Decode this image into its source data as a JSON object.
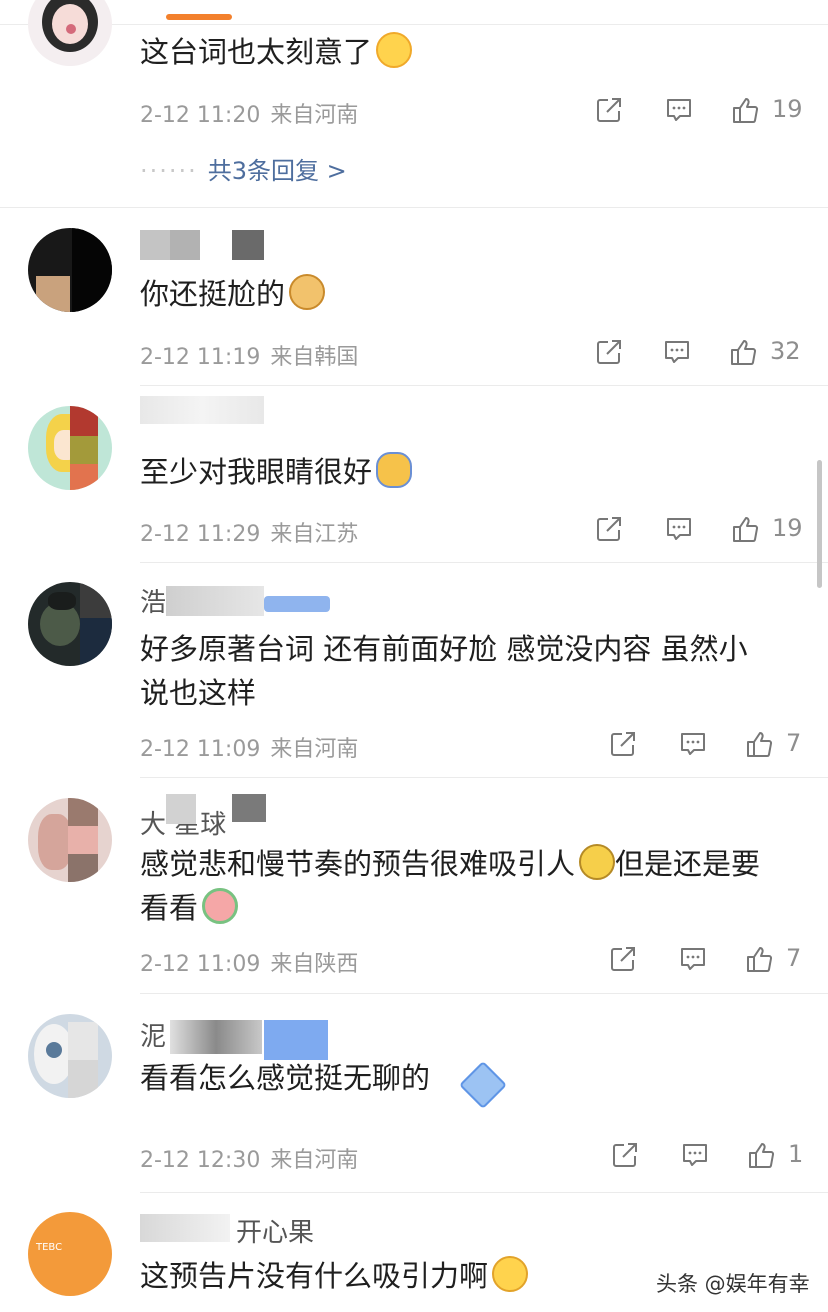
{
  "comments": [
    {
      "text": "这台词也太刻意了",
      "emoji": "laughing-crying-emoji",
      "date": "2-12 11:20",
      "location": "来自河南",
      "likes": "19",
      "replies_label": "共3条回复 >"
    },
    {
      "text": "你还挺尬的",
      "emoji": "doge-emoji",
      "date": "2-12 11:19",
      "location": "来自韩国",
      "likes": "32"
    },
    {
      "text": "至少对我眼睛很好",
      "emoji": "waving-emoji",
      "date": "2-12 11:29",
      "location": "来自江苏",
      "likes": "19"
    },
    {
      "name_visible": "浩",
      "text_line1": "好多原著台词 还有前面好尬 感觉没内容 虽然小",
      "text_line2": "说也这样",
      "date": "2-12 11:09",
      "location": "来自河南",
      "likes": "7"
    },
    {
      "name_visible": "大 星球",
      "text_line1": "感觉悲和慢节奏的预告很难吸引人",
      "text_line1b": "但是还是要",
      "text_line2": "看看",
      "emoji": "eye-roll-emoji",
      "emoji2": "flower-emoji",
      "date": "2-12 11:09",
      "location": "来自陕西",
      "likes": "7"
    },
    {
      "name_visible": "泥",
      "text": "看看怎么感觉挺无聊的",
      "emoji": "diamond-sticker",
      "date": "2-12 12:30",
      "location": "来自河南",
      "likes": "1"
    },
    {
      "name_visible": "开心果",
      "text": "这预告片没有什么吸引力啊",
      "emoji": "shocked-emoji",
      "avatar_text": "TEBC"
    }
  ],
  "watermark": "头条 @娱年有幸",
  "colors": {
    "accent": "#f3802c",
    "link": "#4e6e9e",
    "meta": "#9a9a9a"
  }
}
